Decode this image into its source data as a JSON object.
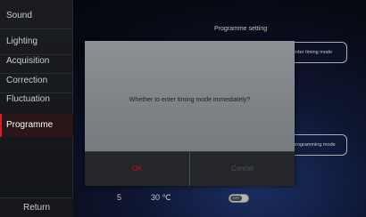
{
  "sidebar": {
    "items": [
      {
        "label": "Sound"
      },
      {
        "label": "Lighting"
      },
      {
        "label": "Acquisition"
      },
      {
        "label": "Correction"
      },
      {
        "label": "Fluctuation"
      },
      {
        "label": "Programme",
        "active": true
      }
    ],
    "return_label": "Return"
  },
  "main": {
    "title": "Programme setting",
    "timing_mode_button": "enter timing mode",
    "programming_mode_button": "programming mode",
    "bottom": {
      "value": "5",
      "temperature": "30 ℃",
      "toggle_label": "OFF"
    }
  },
  "dialog": {
    "message": "Whether to enter timing mode immediately?",
    "ok_label": "OK",
    "cancel_label": "Cancel"
  },
  "colors": {
    "accent_red": "#c0141e",
    "active_border": "#d0202a"
  }
}
